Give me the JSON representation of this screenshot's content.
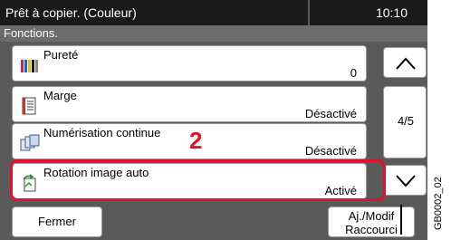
{
  "status": {
    "title": "Prêt à copier. (Couleur)",
    "time": "10:10"
  },
  "section": {
    "title": "Fonctions."
  },
  "items": [
    {
      "label": "Pureté",
      "value": "0",
      "icon": "color-density-icon"
    },
    {
      "label": "Marge",
      "value": "Désactivé",
      "icon": "margin-icon"
    },
    {
      "label": "Numérisation continue",
      "value": "Désactivé",
      "icon": "continuous-scan-icon"
    },
    {
      "label": "Rotation image auto",
      "value": "Activé",
      "icon": "auto-rotate-icon"
    }
  ],
  "pager": {
    "indicator": "4/5"
  },
  "callout": {
    "step": "2"
  },
  "buttons": {
    "close": "Fermer",
    "shortcut": "Aj./Modif Raccourci"
  },
  "figure_id": "GB0002_02",
  "colors": {
    "highlight": "#e0132c",
    "status_bar": "#1a1a1a",
    "panel_bg": "#5a5a5a"
  }
}
